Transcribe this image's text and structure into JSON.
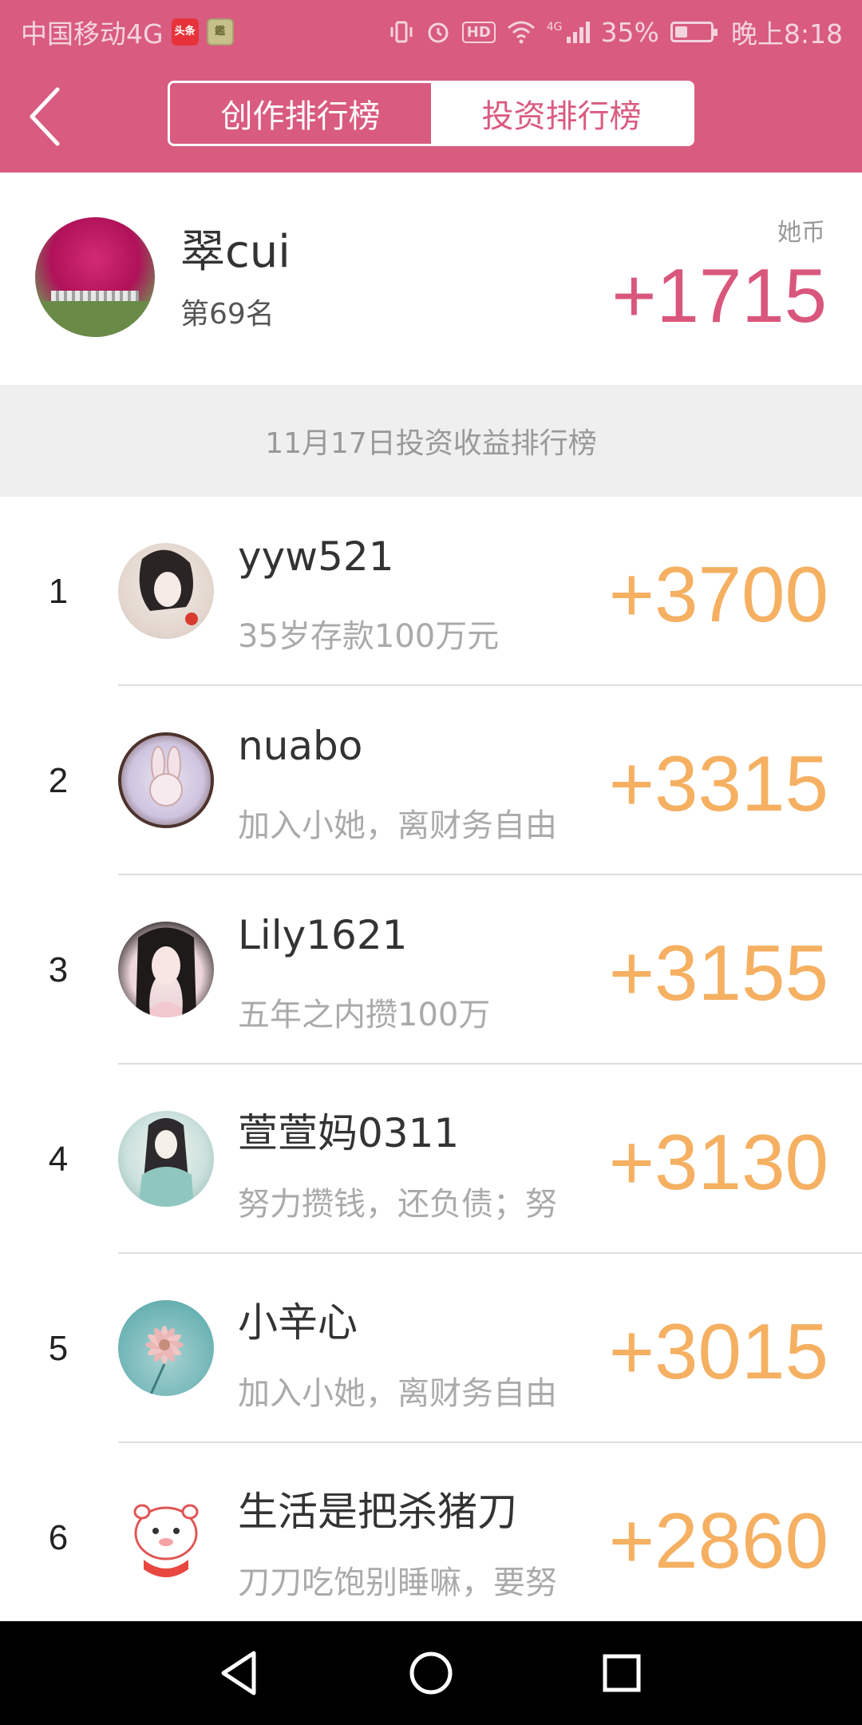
{
  "status_bar": {
    "carrier": "中国移动4G",
    "app_badge_1": "头条",
    "app_badge_2": "鑑",
    "hd_label": "HD",
    "network_label": "4G",
    "battery_percent": "35%",
    "battery_level": 0.35,
    "time": "晚上8:18"
  },
  "header": {
    "tabs": [
      {
        "label": "创作排行榜",
        "active": false
      },
      {
        "label": "投资排行榜",
        "active": true
      }
    ]
  },
  "current_user": {
    "name": "翠cui",
    "rank": "第69名",
    "currency_label": "她币",
    "score": "+1715"
  },
  "section_title": "11月17日投资收益排行榜",
  "rankings": [
    {
      "rank": "1",
      "name": "yyw521",
      "desc": "35岁存款100万元",
      "score": "+3700"
    },
    {
      "rank": "2",
      "name": "nuabo",
      "desc": "加入小她，离财务自由",
      "score": "+3315"
    },
    {
      "rank": "3",
      "name": "Lily1621",
      "desc": "五年之内攒100万",
      "score": "+3155"
    },
    {
      "rank": "4",
      "name": "萱萱妈0311",
      "desc": "努力攒钱，还负债；努",
      "score": "+3130"
    },
    {
      "rank": "5",
      "name": "小辛心",
      "desc": "加入小她，离财务自由",
      "score": "+3015"
    },
    {
      "rank": "6",
      "name": "生活是把杀猪刀",
      "desc": "刀刀吃饱别睡嘛，要努",
      "score": "+2860"
    }
  ],
  "colors": {
    "brand_pink": "#d95b7f",
    "score_orange": "#f5b062",
    "user_score_pink": "#d9577d"
  },
  "icons": {
    "back": "chevron-left-icon",
    "nav_back": "triangle-back-icon",
    "nav_home": "circle-home-icon",
    "nav_recents": "square-recents-icon"
  }
}
